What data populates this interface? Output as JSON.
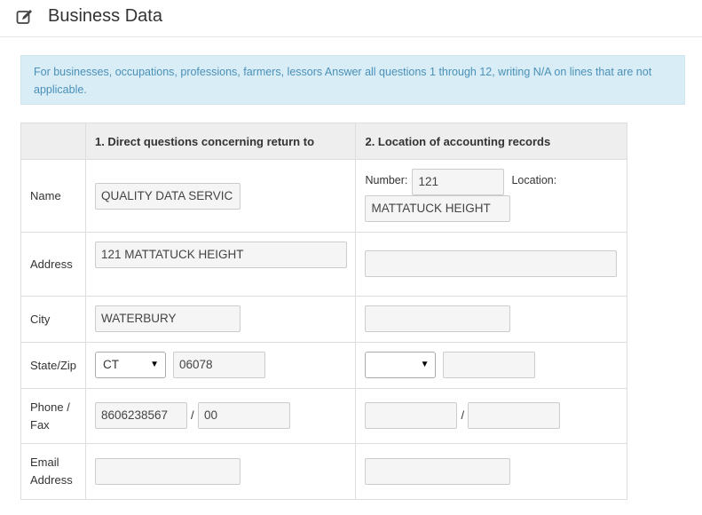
{
  "header": {
    "icon": "edit-icon",
    "title": "Business Data"
  },
  "notice": {
    "text": "For businesses, occupations, professions, farmers, lessors Answer all questions 1 through 12, writing N/A on lines that are not applicable."
  },
  "table": {
    "headers": {
      "col1": "1. Direct questions concerning return to",
      "col2": "2. Location of accounting records"
    },
    "labels": {
      "name": "Name",
      "address": "Address",
      "city": "City",
      "state_zip": "State/Zip",
      "phone_fax": "Phone / Fax",
      "email": "Email Address"
    },
    "return_contact": {
      "name": "QUALITY DATA SERVIC",
      "address": "121 MATTATUCK HEIGHT",
      "city": "WATERBURY",
      "state": "CT",
      "zip": "06078",
      "phone": "8606238567",
      "fax": "00",
      "email": ""
    },
    "records_location": {
      "number_label": "Number:",
      "number": "121",
      "location_label": "Location:",
      "location": "MATTATUCK HEIGHT",
      "address": "",
      "city": "",
      "state": "",
      "zip": "",
      "phone": "",
      "fax": "",
      "email": ""
    },
    "separator": "/"
  }
}
